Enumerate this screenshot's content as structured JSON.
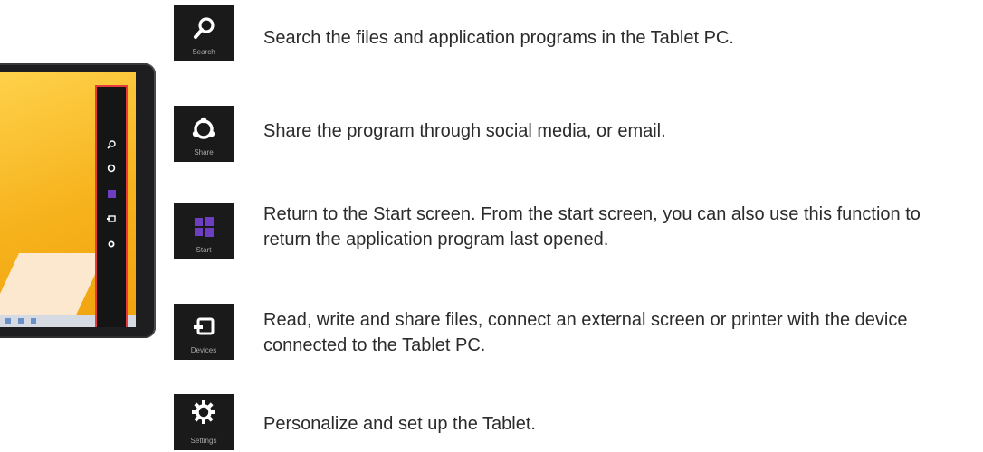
{
  "charms": [
    {
      "icon": "search-icon",
      "caption": "Search",
      "description": "Search the files and application programs in the Tablet PC."
    },
    {
      "icon": "share-icon",
      "caption": "Share",
      "description": "Share the program through social media, or email."
    },
    {
      "icon": "start-icon",
      "caption": "Start",
      "description": "Return to the Start screen. From the start screen, you can also use this function to return the application program last opened."
    },
    {
      "icon": "devices-icon",
      "caption": "Devices",
      "description": "Read, write and share files, connect an external screen or printer with the device connected to the Tablet PC."
    },
    {
      "icon": "settings-icon",
      "caption": "Settings",
      "description": "Personalize and set up the Tablet."
    }
  ],
  "colors": {
    "tile_bg": "#1a1a1a",
    "start_accent": "#6e3ec2",
    "highlight_border": "#e63c3c",
    "screen_bg": "#f4b81f"
  }
}
